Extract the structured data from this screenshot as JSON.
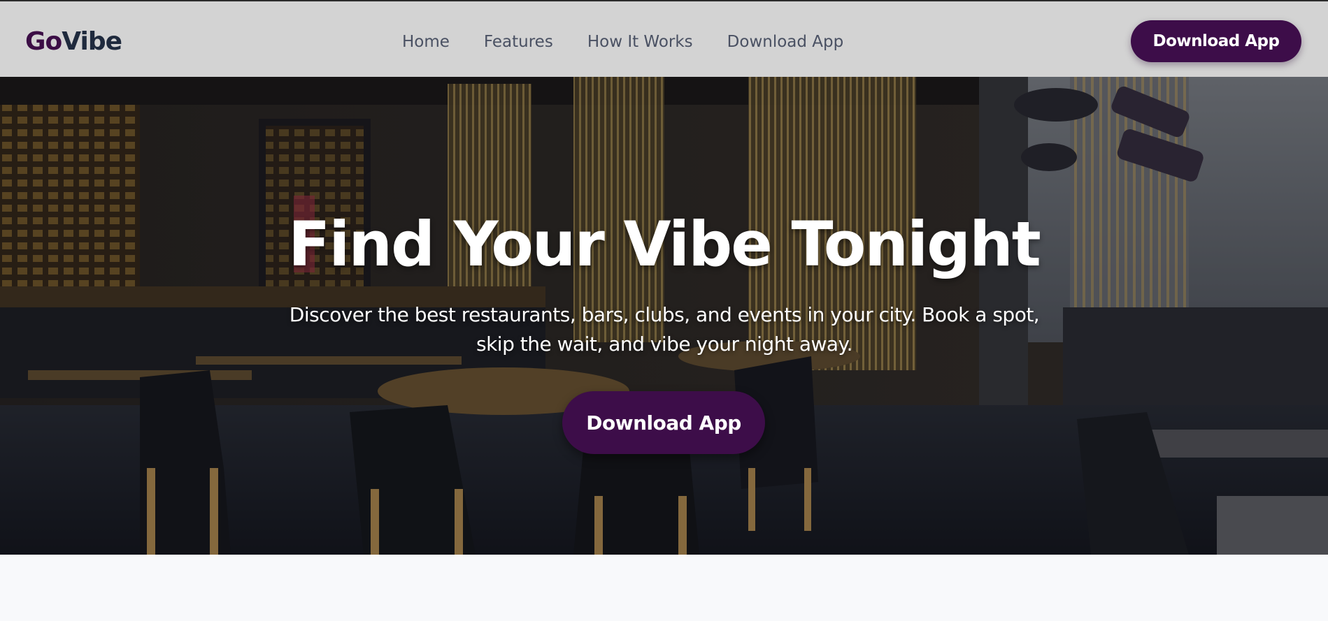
{
  "nav": {
    "logo_part1": "Go",
    "logo_part2": "Vibe",
    "links": [
      "Home",
      "Features",
      "How It Works",
      "Download App"
    ],
    "cta_label": "Download App"
  },
  "hero": {
    "title": "Find Your Vibe Tonight",
    "subtitle": "Discover the best restaurants, bars, clubs, and events in your city. Book a spot, skip the wait, and vibe your night away.",
    "cta_label": "Download App"
  },
  "colors": {
    "brand_purple": "#3d0d49",
    "nav_bg": "#d3d3d3",
    "nav_text": "#4a5163",
    "logo_dark": "#1f2a3d"
  }
}
